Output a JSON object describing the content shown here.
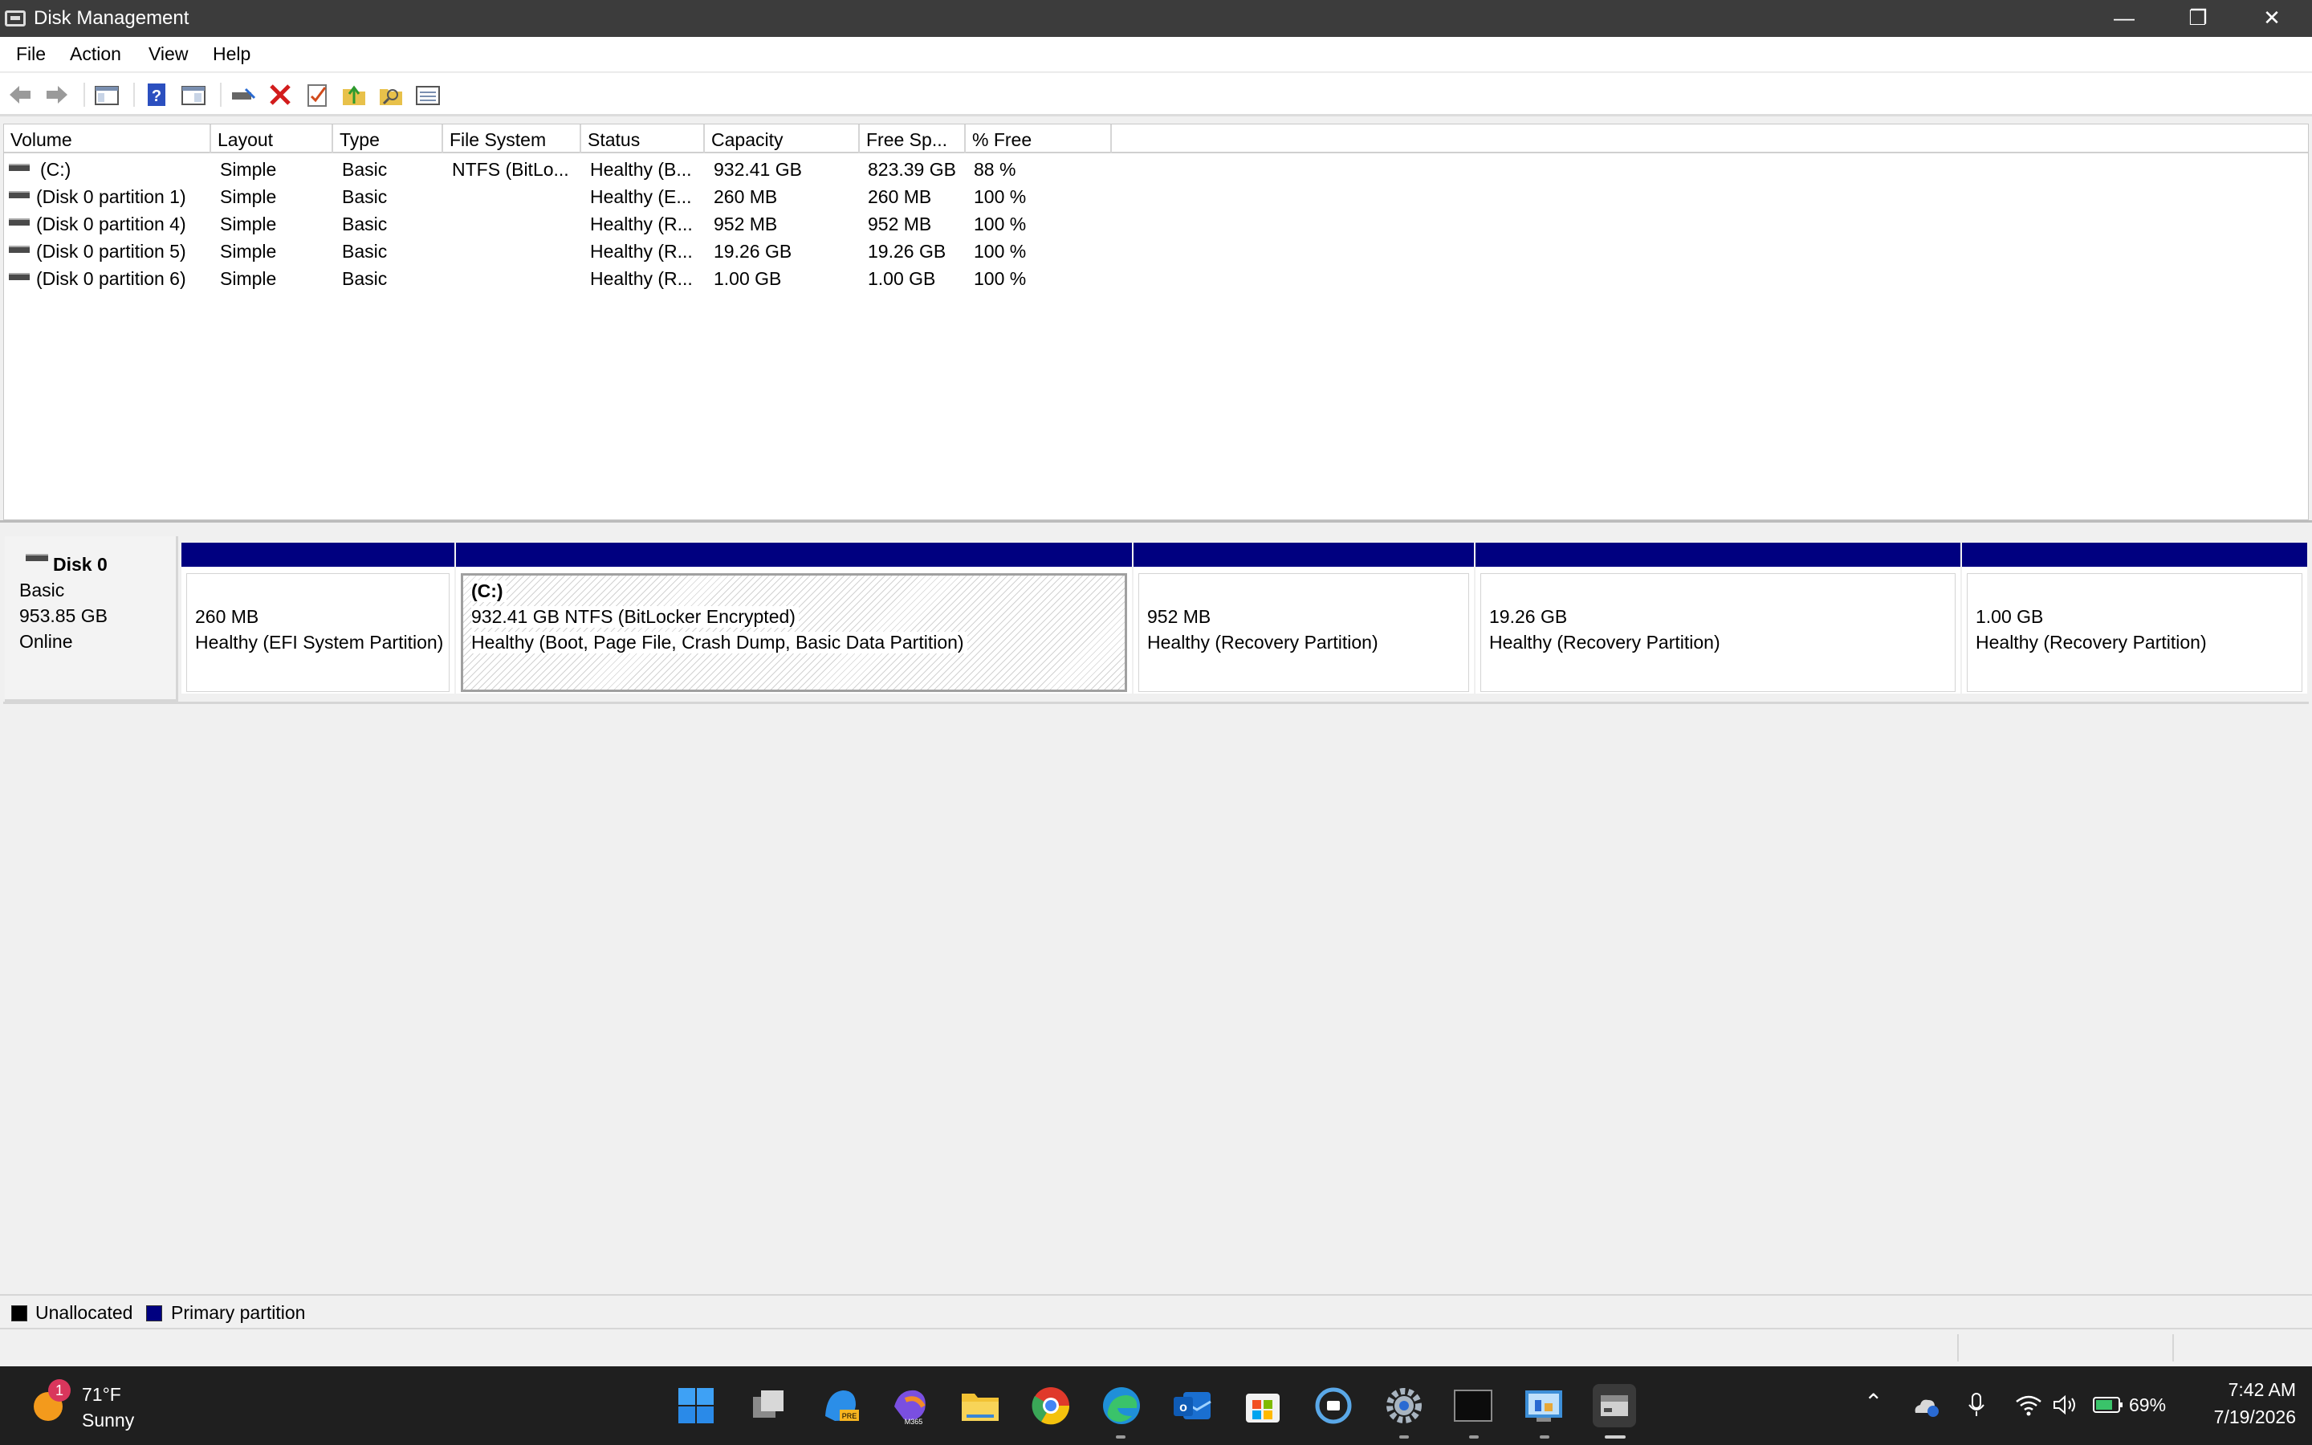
{
  "window": {
    "title": "Disk Management",
    "minimize_icon": "minimize-icon",
    "maximize_icon": "restore-icon",
    "close_icon": "close-icon"
  },
  "menu": [
    "File",
    "Action",
    "View",
    "Help"
  ],
  "toolbar": [
    "back-arrow-icon",
    "forward-arrow-icon",
    "show-hide-console-tree-icon",
    "help-icon",
    "properties-icon",
    "connect-drive-icon",
    "delete-icon",
    "check-icon",
    "up-folder-icon",
    "search-folder-icon",
    "view-list-icon"
  ],
  "volume_list": {
    "columns": [
      "Volume",
      "Layout",
      "Type",
      "File System",
      "Status",
      "Capacity",
      "Free Sp...",
      "% Free"
    ],
    "rows": [
      [
        "(C:)",
        "Simple",
        "Basic",
        "NTFS (BitLo...",
        "Healthy (B...",
        "932.41 GB",
        "823.39 GB",
        "88 %"
      ],
      [
        "(Disk 0 partition 1)",
        "Simple",
        "Basic",
        "",
        "Healthy (E...",
        "260 MB",
        "260 MB",
        "100 %"
      ],
      [
        "(Disk 0 partition 4)",
        "Simple",
        "Basic",
        "",
        "Healthy (R...",
        "952 MB",
        "952 MB",
        "100 %"
      ],
      [
        "(Disk 0 partition 5)",
        "Simple",
        "Basic",
        "",
        "Healthy (R...",
        "19.26 GB",
        "19.26 GB",
        "100 %"
      ],
      [
        "(Disk 0 partition 6)",
        "Simple",
        "Basic",
        "",
        "Healthy (R...",
        "1.00 GB",
        "1.00 GB",
        "100 %"
      ]
    ]
  },
  "disk": {
    "name": "Disk 0",
    "type": "Basic",
    "size": "953.85 GB",
    "state": "Online",
    "partitions": [
      {
        "label": "",
        "size": "260 MB",
        "status": "Healthy (EFI System Partition)"
      },
      {
        "label": "(C:)",
        "size": "932.41 GB NTFS (BitLocker Encrypted)",
        "status": "Healthy (Boot, Page File, Crash Dump, Basic Data Partition)"
      },
      {
        "label": "",
        "size": "952 MB",
        "status": "Healthy (Recovery Partition)"
      },
      {
        "label": "",
        "size": "19.26 GB",
        "status": "Healthy (Recovery Partition)"
      },
      {
        "label": "",
        "size": "1.00 GB",
        "status": "Healthy (Recovery Partition)"
      }
    ]
  },
  "legend": [
    {
      "label": "Unallocated",
      "color": "#000000"
    },
    {
      "label": "Primary partition",
      "color": "#000080"
    }
  ],
  "taskbar": {
    "weather": {
      "temp": "71°F",
      "condition": "Sunny",
      "badge": "1"
    },
    "apps": [
      "start-icon",
      "task-view-icon",
      "copilot-pre-icon",
      "m365-icon",
      "file-explorer-icon",
      "chrome-icon",
      "edge-icon",
      "outlook-icon",
      "store-icon",
      "media-app-icon",
      "settings-icon",
      "terminal-icon",
      "control-panel-icon",
      "disk-management-icon"
    ],
    "battery": "69%",
    "time": "7:42 AM",
    "date": "7/19/2026"
  }
}
